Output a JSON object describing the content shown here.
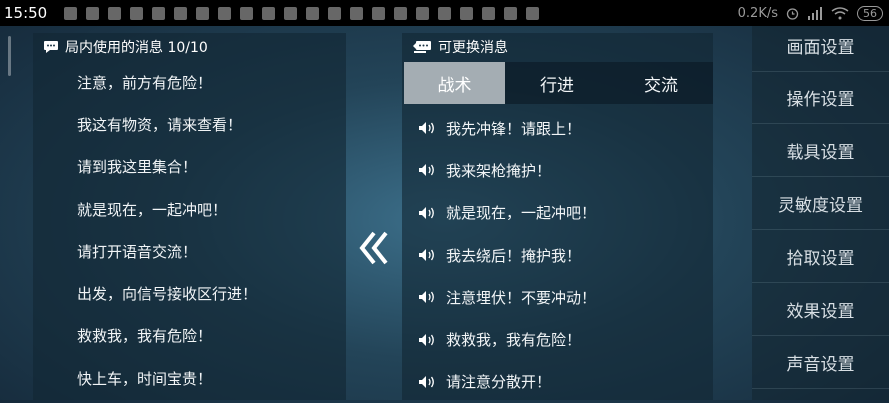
{
  "status_bar": {
    "time": "15:50",
    "network_speed": "0.2K/s",
    "battery": "56"
  },
  "left_panel": {
    "title": "局内使用的消息 10/10",
    "icon": "chat-bubble-icon",
    "messages": [
      "注意，前方有危险！",
      "我这有物资，请来查看！",
      "请到我这里集合！",
      "就是现在，一起冲吧！",
      "请打开语音交流！",
      "出发，向信号接收区行进！",
      "救救我，我有危险！",
      "快上车，时间宝贵！"
    ]
  },
  "swap_button": {
    "icon": "double-chevron-left-icon"
  },
  "right_panel": {
    "title": "可更换消息",
    "icon": "swap-message-icon",
    "tabs": [
      "战术",
      "行进",
      "交流"
    ],
    "active_tab": "战术",
    "messages": [
      "我先冲锋！请跟上！",
      "我来架枪掩护！",
      "就是现在，一起冲吧！",
      "我去绕后！掩护我！",
      "注意埋伏！不要冲动！",
      "救救我，我有危险！",
      "请注意分散开！"
    ]
  },
  "settings_menu": {
    "items": [
      "画面设置",
      "操作设置",
      "载具设置",
      "灵敏度设置",
      "拾取设置",
      "效果设置",
      "声音设置"
    ]
  },
  "colors": {
    "active_tab_bg": "#a4adb3",
    "panel_bg": "#122634",
    "status_bar_bg": "#000000"
  }
}
